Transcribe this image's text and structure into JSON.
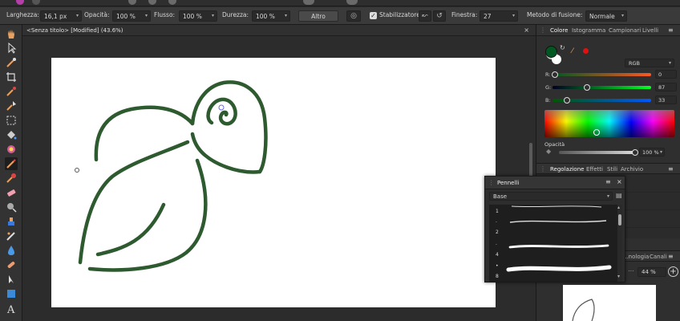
{
  "toolbar": {
    "larghezza_label": "Larghezza:",
    "larghezza_value": "16,1 px",
    "opacita_label": "Opacità:",
    "opacita_value": "100 %",
    "flusso_label": "Flusso:",
    "flusso_value": "100 %",
    "durezza_label": "Durezza:",
    "durezza_value": "100 %",
    "altro_label": "Altro",
    "stabilizzatore_label": "Stabilizzatore",
    "stabilizzatore_checked": true,
    "finestra_label": "Finestra:",
    "finestra_value": "27",
    "metodo_label": "Metodo di fusione:",
    "metodo_value": "Normale"
  },
  "document": {
    "tab_title": "<Senza titolo> [Modified] (43.6%)",
    "close_glyph": "×",
    "stroke_color": "#2e5a2f"
  },
  "color_panel": {
    "tabs": [
      "Colore",
      "Istogramma",
      "Campionari",
      "Livelli"
    ],
    "active_tab": "Colore",
    "primary_color": "#005721",
    "mode": "RGB",
    "r_label": "R:",
    "r_value": "0",
    "g_label": "G:",
    "g_value": "87",
    "b_label": "B:",
    "b_value": "33",
    "opacity_label": "Opacità",
    "opacity_value": "100 %"
  },
  "adjust_tabs": [
    "Regolazione",
    "Effetti",
    "Stili",
    "Archivio"
  ],
  "navigator": {
    "tabs_visible": [
      "...nologia",
      "Canali"
    ],
    "zoom_value": "44 %",
    "zoom_plus": "+"
  },
  "brushes_panel": {
    "title": "Pennelli",
    "category": "Base",
    "items": [
      {
        "label": "1",
        "size": ""
      },
      {
        "label": "2",
        "size": "."
      },
      {
        "label": "4",
        "size": "."
      },
      {
        "label": "8",
        "size": "•"
      }
    ]
  },
  "icons": {
    "menu": "≡",
    "close": "×",
    "dropdown": "▾"
  }
}
